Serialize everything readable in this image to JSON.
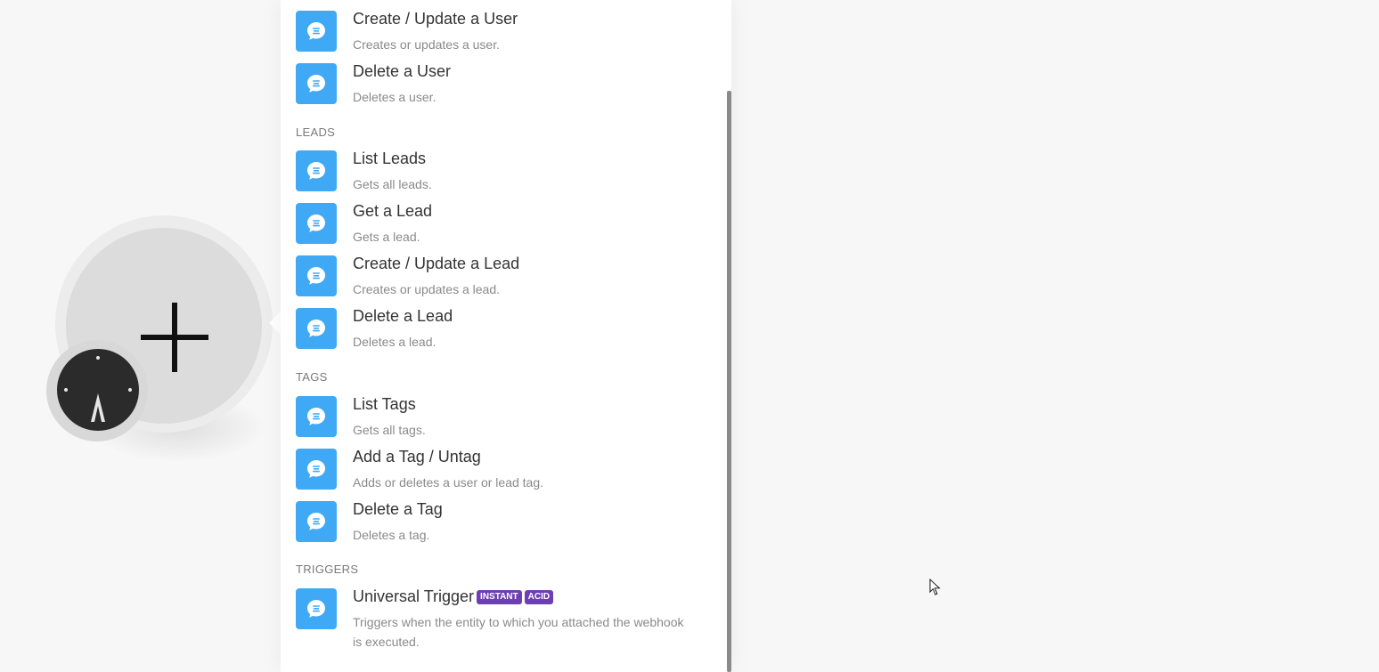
{
  "sections": [
    {
      "label": "",
      "items": [
        {
          "title": "Create / Update a User",
          "desc": "Creates or updates a user."
        },
        {
          "title": "Delete a User",
          "desc": "Deletes a user."
        }
      ]
    },
    {
      "label": "LEADS",
      "items": [
        {
          "title": "List Leads",
          "desc": "Gets all leads."
        },
        {
          "title": "Get a Lead",
          "desc": "Gets a lead."
        },
        {
          "title": "Create / Update a Lead",
          "desc": "Creates or updates a lead."
        },
        {
          "title": "Delete a Lead",
          "desc": "Deletes a lead."
        }
      ]
    },
    {
      "label": "TAGS",
      "items": [
        {
          "title": "List Tags",
          "desc": "Gets all tags."
        },
        {
          "title": "Add a Tag / Untag",
          "desc": "Adds or deletes a user or lead tag."
        },
        {
          "title": "Delete a Tag",
          "desc": "Deletes a tag."
        }
      ]
    },
    {
      "label": "TRIGGERS",
      "items": [
        {
          "title": "Universal Trigger",
          "desc": "Triggers when the entity to which you attached the webhook is executed.",
          "badges": [
            "INSTANT",
            "ACID"
          ]
        }
      ]
    }
  ],
  "icons": {
    "module": "chat-bubble-icon",
    "placeholder": "plus-icon",
    "schedule": "clock-icon",
    "pointer": "mouse-cursor-icon"
  },
  "colors": {
    "icon_bg": "#3fa9f5",
    "badge_bg": "#6d3fb3"
  }
}
